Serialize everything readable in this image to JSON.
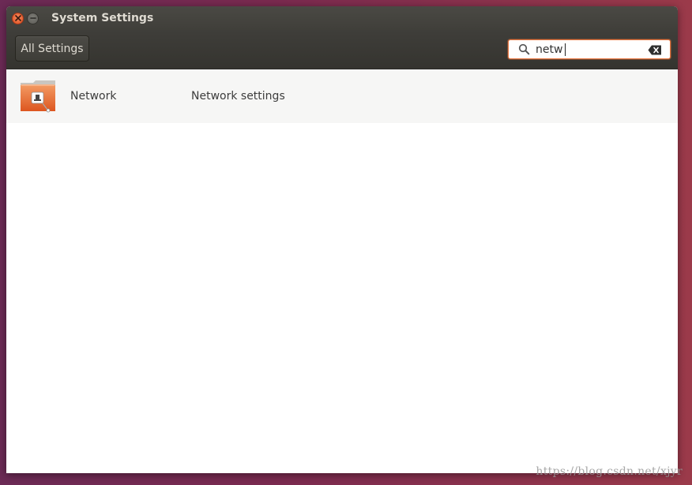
{
  "window": {
    "title": "System Settings"
  },
  "toolbar": {
    "all_settings_label": "All Settings"
  },
  "search": {
    "value": "netw",
    "search_icon": "magnifier-icon",
    "clear_icon": "backspace-clear-icon"
  },
  "results": [
    {
      "icon": "network-folder-icon",
      "name": "Network",
      "description": "Network settings"
    }
  ],
  "watermark": "https://blog.csdn.net/xjyr",
  "colors": {
    "accent": "#e9753e",
    "titlebar": "#403f3a",
    "toolbar": "#3a3934",
    "row_background": "#f6f6f5",
    "close_button": "#e0501f"
  }
}
